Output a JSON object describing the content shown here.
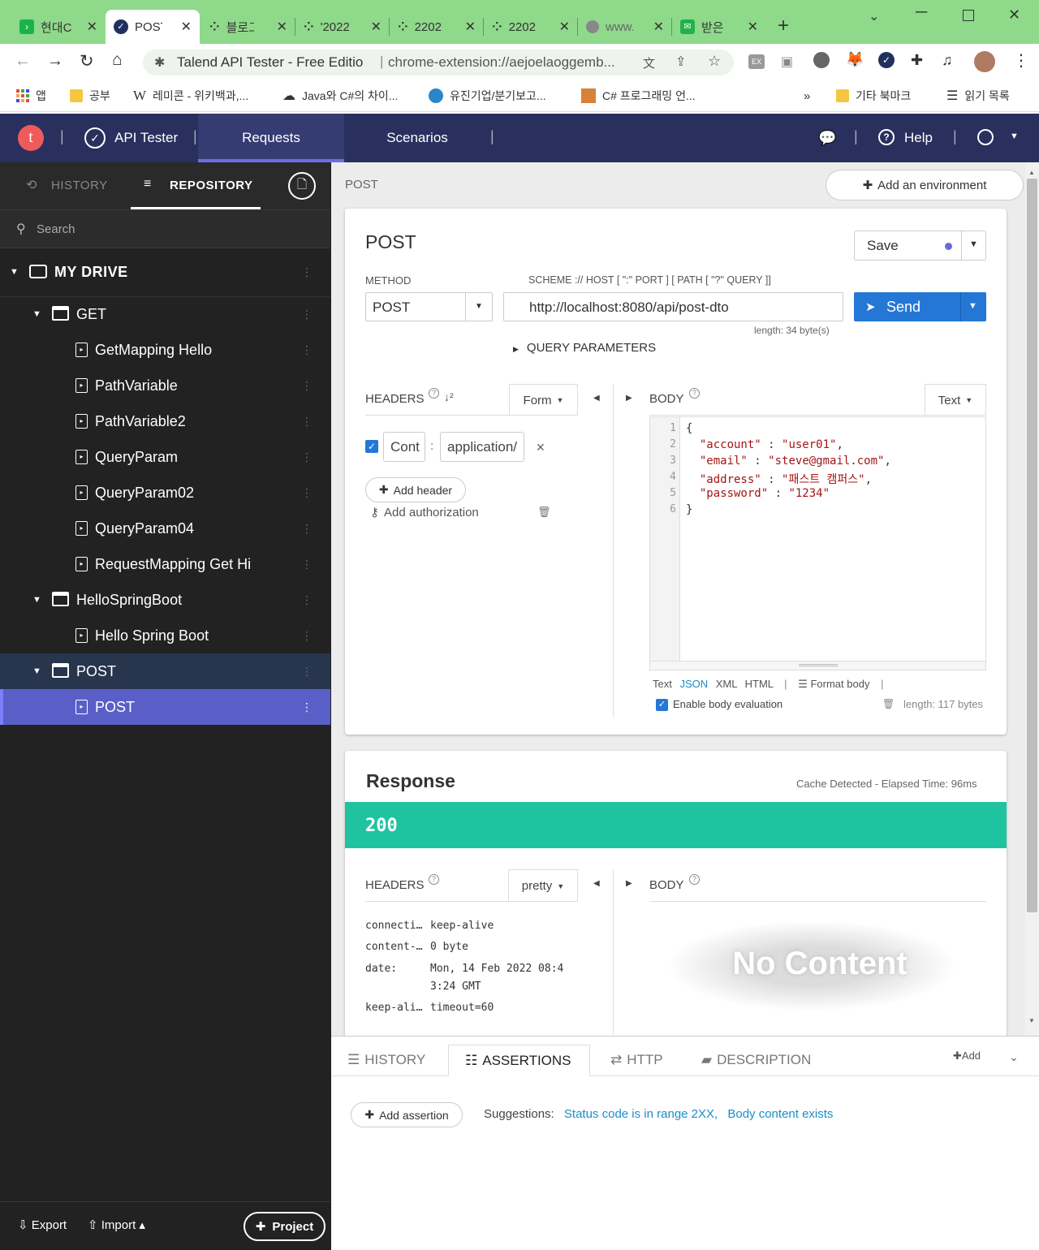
{
  "browser": {
    "tabs": [
      {
        "title": "현대C"
      },
      {
        "title": "POST"
      },
      {
        "title": "블로그"
      },
      {
        "title": "'2022"
      },
      {
        "title": "2202"
      },
      {
        "title": "2202"
      },
      {
        "title": "www."
      },
      {
        "title": "받은"
      }
    ],
    "address_title": "Talend API Tester - Free Editio",
    "address_url": "chrome-extension://aejoelaoggemb...",
    "bookmarks": [
      {
        "label": "앱"
      },
      {
        "label": "공부"
      },
      {
        "label": "레미콘 - 위키백과,..."
      },
      {
        "label": "Java와 C#의 차이..."
      },
      {
        "label": "유진기업/분기보고..."
      },
      {
        "label": "C# 프로그래밍 언..."
      },
      {
        "label": "기타 북마크"
      },
      {
        "label": "읽기 목록"
      }
    ],
    "bookmarks_more": "»"
  },
  "app": {
    "logo_letter": "t",
    "title": "API Tester",
    "nav": {
      "requests": "Requests",
      "scenarios": "Scenarios"
    },
    "help": "Help"
  },
  "sidebar": {
    "tabs": {
      "history": "HISTORY",
      "repository": "REPOSITORY"
    },
    "search_placeholder": "Search",
    "drive": "MY DRIVE",
    "tree": [
      {
        "label": "GET",
        "type": "folder"
      },
      {
        "label": "GetMapping Hello",
        "type": "request"
      },
      {
        "label": "PathVariable",
        "type": "request"
      },
      {
        "label": "PathVariable2",
        "type": "request"
      },
      {
        "label": "QueryParam",
        "type": "request"
      },
      {
        "label": "QueryParam02",
        "type": "request"
      },
      {
        "label": "QueryParam04",
        "type": "request"
      },
      {
        "label": "RequestMapping Get Hi",
        "type": "request"
      },
      {
        "label": "HelloSpringBoot",
        "type": "folder"
      },
      {
        "label": "Hello Spring Boot",
        "type": "request"
      },
      {
        "label": "POST",
        "type": "folder"
      },
      {
        "label": "POST",
        "type": "request"
      }
    ],
    "footer": {
      "export": "Export",
      "import": "Import",
      "project": "Project"
    }
  },
  "request": {
    "breadcrumb": "POST",
    "add_environment": "Add an environment",
    "name": "POST",
    "save": "Save",
    "method_label": "METHOD",
    "method": "POST",
    "url_label": "SCHEME :// HOST [ \":\" PORT ] [ PATH [ \"?\" QUERY ]]",
    "url": "http://localhost:8080/api/post-dto",
    "url_length": "length: 34 byte(s)",
    "send": "Send",
    "query_params": "QUERY PARAMETERS",
    "headers_label": "HEADERS",
    "headers_mode": "Form",
    "header_key": "Cont",
    "header_value": "application/",
    "add_header": "Add header",
    "add_authorization": "Add authorization",
    "body_label": "BODY",
    "body_mode": "Text",
    "body_lines": [
      {
        "n": "1",
        "text": "{"
      },
      {
        "n": "2",
        "key": "\"account\"",
        "val": "\"user01\"",
        "tail": ","
      },
      {
        "n": "3",
        "key": "\"email\"",
        "val": "\"steve@gmail.com\"",
        "tail": ","
      },
      {
        "n": "4",
        "key": "\"address\"",
        "val": "\"패스트 캠퍼스\"",
        "tail": ","
      },
      {
        "n": "5",
        "key": "\"password\"",
        "val": "\"1234\"",
        "tail": ""
      },
      {
        "n": "6",
        "text": "}"
      }
    ],
    "body_formats": {
      "text": "Text",
      "json": "JSON",
      "xml": "XML",
      "html": "HTML"
    },
    "format_body": "Format body",
    "enable_eval": "Enable body evaluation",
    "body_length": "length: 117 bytes"
  },
  "response": {
    "title": "Response",
    "meta": "Cache Detected - Elapsed Time: 96ms",
    "status": "200",
    "headers_label": "HEADERS",
    "headers_mode": "pretty",
    "headers": [
      {
        "k": "connecti…",
        "v": "keep-alive"
      },
      {
        "k": "content-…",
        "v": "0 byte"
      },
      {
        "k": "date:",
        "v": "Mon, 14 Feb 2022 08:4",
        "v2": "3:24 GMT"
      },
      {
        "k": "keep-ali…",
        "v": "timeout=60"
      }
    ],
    "body_label": "BODY",
    "no_content": "No Content"
  },
  "bottom": {
    "tabs": {
      "history": "HISTORY",
      "assertions": "ASSERTIONS",
      "http": "HTTP",
      "description": "DESCRIPTION"
    },
    "add": "Add",
    "add_assertion": "Add assertion",
    "suggestions_label": "Suggestions:",
    "suggestion1": "Status code is in range 2XX,",
    "suggestion2": "Body content exists"
  },
  "colors": {
    "status_ok": "#20c3a0",
    "send": "#2577d6",
    "header_bg": "#29305e",
    "selected_row": "#5a5fc7",
    "tabbar": "#8fd98a"
  }
}
